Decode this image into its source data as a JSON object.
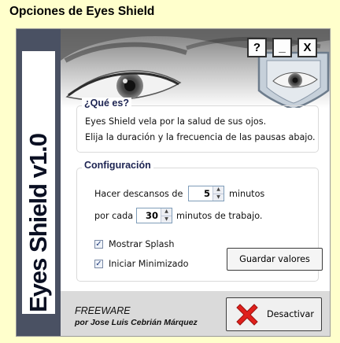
{
  "window": {
    "title": "Opciones de Eyes Shield",
    "buttons": {
      "help": "?",
      "minimize": "_",
      "close": "X"
    }
  },
  "sidebar": {
    "brand": "Eyes Shield v1.0"
  },
  "about": {
    "heading": "¿Qué es?",
    "line1": "Eyes Shield vela por la salud de sus ojos.",
    "line2": "Elija la duración y la frecuencia de las pausas abajo."
  },
  "config": {
    "heading": "Configuración",
    "break_prefix": "Hacer descansos de",
    "break_value": "5",
    "break_suffix": "minutos",
    "freq_prefix": "por cada",
    "freq_value": "30",
    "freq_suffix": "minutos de trabajo.",
    "show_splash_label": "Mostrar Splash",
    "show_splash_checked": true,
    "start_min_label": "Iniciar Minimizado",
    "start_min_checked": true,
    "save_label": "Guardar valores"
  },
  "footer": {
    "license": "FREEWARE",
    "author": "por Jose Luis Cebrián Márquez",
    "deactivate_label": "Desactivar"
  },
  "colors": {
    "background": "#ffffcc",
    "sidebar": "#4a5163",
    "heading": "#1d2452",
    "deactivate_icon": "#e0201c"
  },
  "icons": {
    "deactivate": "red-x-icon",
    "checkbox": "check-icon",
    "spin_up": "arrow-up-icon",
    "spin_down": "arrow-down-icon"
  }
}
